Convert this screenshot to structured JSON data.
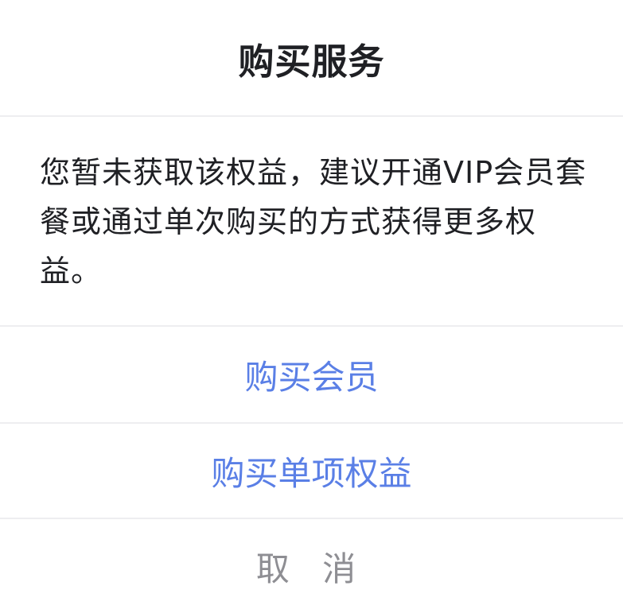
{
  "dialog": {
    "title": "购买服务",
    "message": "您暂未获取该权益，建议开通VIP会员套餐或通过单次购买的方式获得更多权益。",
    "buy_membership_label": "购买会员",
    "buy_single_benefit_label": "购买单项权益",
    "cancel_label": "取 消"
  },
  "colors": {
    "title_text": "#1f2024",
    "action_blue": "#5a7fe6",
    "cancel_gray": "#8e8e93",
    "divider": "#eeeef0"
  }
}
